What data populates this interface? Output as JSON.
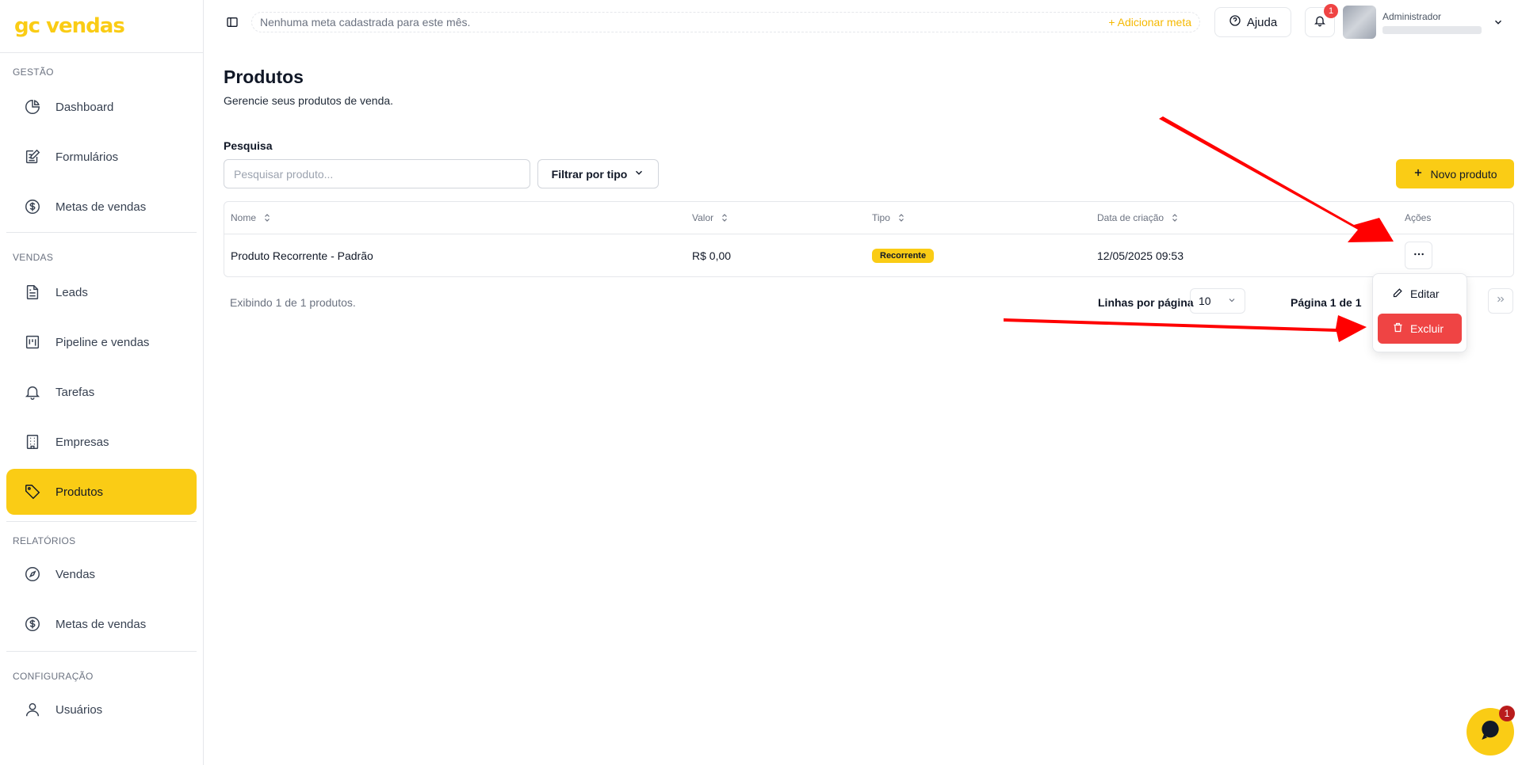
{
  "brand": {
    "logo_text": "gc vendas",
    "accent": "#facc15"
  },
  "sidebar": {
    "sections": [
      {
        "label": "GESTÃO",
        "items": [
          {
            "label": "Dashboard",
            "icon": "pie-chart-icon"
          },
          {
            "label": "Formulários",
            "icon": "form-edit-icon"
          },
          {
            "label": "Metas de vendas",
            "icon": "dollar-circle-icon"
          }
        ]
      },
      {
        "label": "VENDAS",
        "items": [
          {
            "label": "Leads",
            "icon": "document-icon"
          },
          {
            "label": "Pipeline e vendas",
            "icon": "kanban-icon"
          },
          {
            "label": "Tarefas",
            "icon": "bell-icon"
          },
          {
            "label": "Empresas",
            "icon": "building-icon"
          },
          {
            "label": "Produtos",
            "icon": "tag-icon",
            "active": true
          }
        ]
      },
      {
        "label": "RELATÓRIOS",
        "items": [
          {
            "label": "Vendas",
            "icon": "compass-icon"
          },
          {
            "label": "Metas de vendas",
            "icon": "dollar-circle-icon"
          }
        ]
      },
      {
        "label": "CONFIGURAÇÃO",
        "items": [
          {
            "label": "Usuários",
            "icon": "user-icon"
          }
        ]
      }
    ]
  },
  "topbar": {
    "goal_text": "Nenhuma meta cadastrada para este mês.",
    "add_goal": "+ Adicionar meta",
    "help_label": "Ajuda",
    "notification_count": "1",
    "user_role": "Administrador"
  },
  "page": {
    "title": "Produtos",
    "subtitle": "Gerencie seus produtos de venda.",
    "search_label": "Pesquisa",
    "search_placeholder": "Pesquisar produto...",
    "filter_label": "Filtrar por tipo",
    "new_button": "Novo produto"
  },
  "table": {
    "columns": [
      "Nome",
      "Valor",
      "Tipo",
      "Data de criação",
      "Ações"
    ],
    "rows": [
      {
        "nome": "Produto Recorrente - Padrão",
        "valor": "R$ 0,00",
        "tipo": "Recorrente",
        "data": "12/05/2025 09:53"
      }
    ]
  },
  "pagination": {
    "count_text": "Exibindo 1 de 1 produtos.",
    "rows_label": "Linhas por página",
    "rows_value": "10",
    "page_text": "Página 1 de 1"
  },
  "action_menu": {
    "edit": "Editar",
    "delete": "Excluir"
  },
  "chat": {
    "badge": "1"
  }
}
